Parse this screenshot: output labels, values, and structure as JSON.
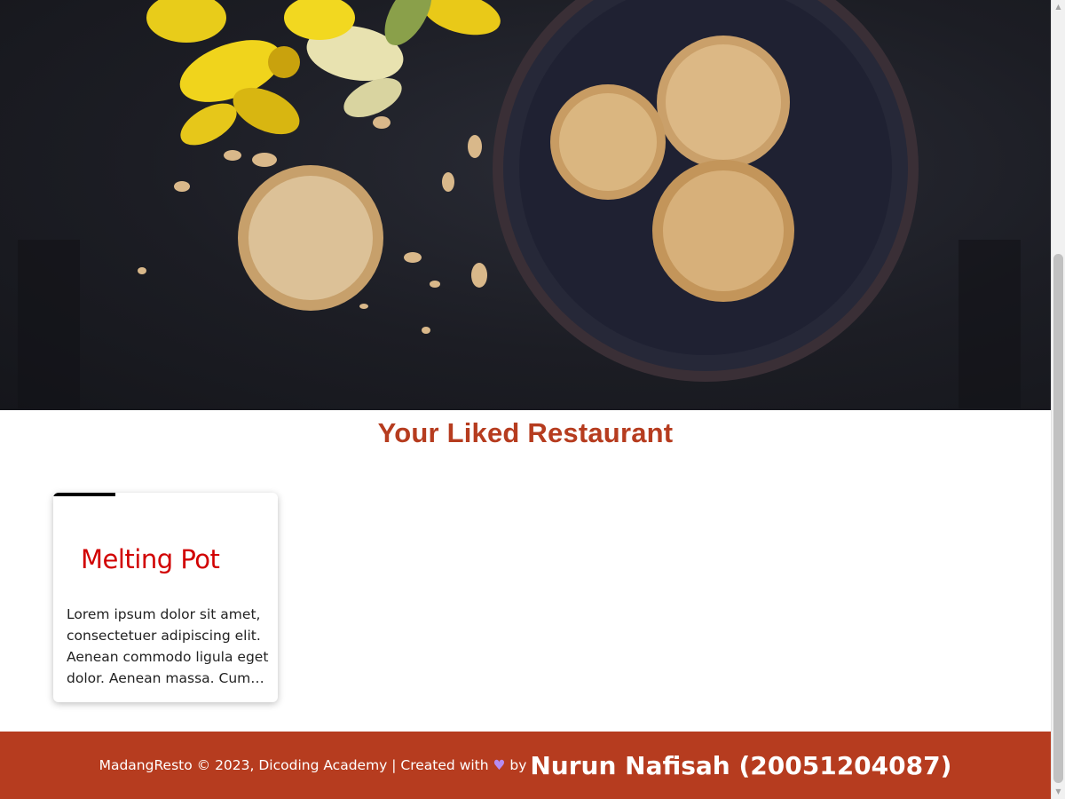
{
  "hero": {
    "image": "cookies-and-daffodils-photo"
  },
  "heading": "Your Liked Restaurant",
  "restaurants": [
    {
      "name": "Melting Pot",
      "description": "Lorem ipsum dolor sit amet, consectetuer adipiscing elit. Aenean commodo ligula eget dolor. Aenean massa. Cum sociis natoque penatibus et magnis dis parturient montes, nascetur ridiculus mus."
    }
  ],
  "footer": {
    "text_before": "MadangResto © 2023, Dicoding Academy | Created with",
    "heart": "♥",
    "text_after": "by",
    "author": "Nurun Nafisah (20051204087)"
  },
  "colors": {
    "accent": "#b63c1f",
    "card_title": "#d10000",
    "heart": "#b68cf0"
  },
  "icons": {
    "scroll_up": "▲",
    "scroll_down": "▼"
  }
}
